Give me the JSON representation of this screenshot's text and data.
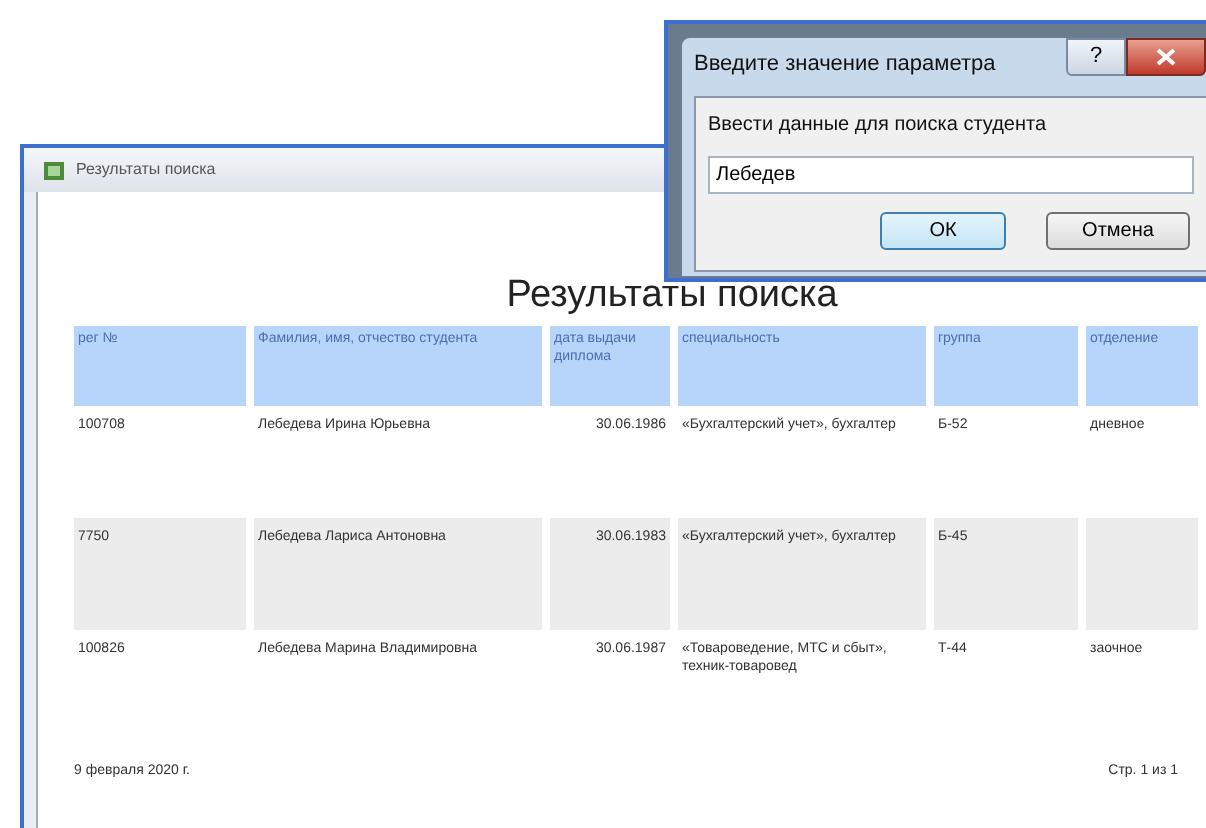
{
  "report_window": {
    "title": "Результаты поиска",
    "heading": "Результаты поиска",
    "table": {
      "columns": [
        "рег №",
        "Фамилия, имя, отчество студента",
        "дата выдачи диплома",
        "специальность",
        "группа",
        "отделение"
      ],
      "rows": [
        {
          "cells": [
            "100708",
            "Лебедева Ирина Юрьевна",
            "30.06.1986",
            "«Бухгалтерский учет», бухгалтер",
            "Б-52",
            "дневное"
          ]
        },
        {
          "cells": [
            "7750",
            "Лебедева Лариса Антоновна",
            "30.06.1983",
            "«Бухгалтерский учет», бухгалтер",
            "Б-45",
            ""
          ]
        },
        {
          "cells": [
            "100826",
            "Лебедева Марина Владимировна",
            "30.06.1987",
            "«Товароведение, МТС и сбыт», техник-товаровед",
            "Т-44",
            "заочное"
          ]
        }
      ]
    },
    "footer": {
      "date": "9 февраля 2020 г.",
      "page": "Стр. 1 из 1"
    }
  },
  "dialog": {
    "title": "Введите значение параметра",
    "help_button": "?",
    "prompt": "Ввести данные для поиска студента",
    "value": "Лебедев",
    "buttons": [
      "ОК",
      "Отмена"
    ]
  }
}
